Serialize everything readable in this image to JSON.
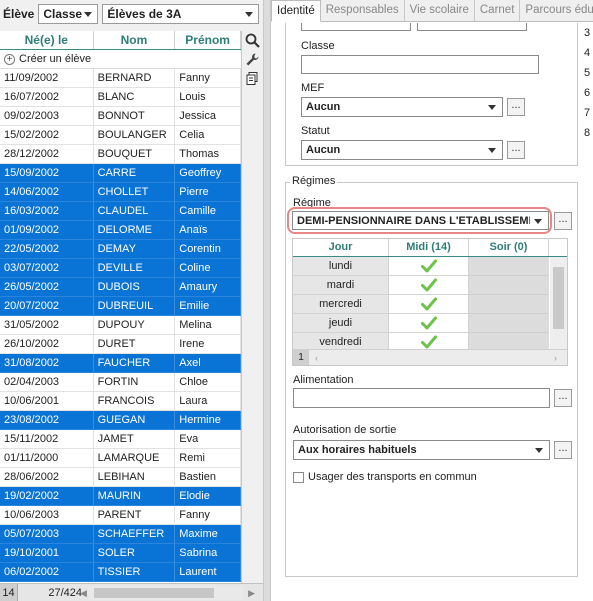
{
  "left": {
    "eleve_label": "Élève",
    "type_select": "Classe",
    "class_select": "Élèves de 3A",
    "columns": [
      "Né(e) le",
      "Nom",
      "Prénom"
    ],
    "create_label": "Créer un élève",
    "students": [
      {
        "date": "11/09/2002",
        "nom": "BERNARD",
        "prenom": "Fanny",
        "sel": false
      },
      {
        "date": "16/07/2002",
        "nom": "BLANC",
        "prenom": "Louis",
        "sel": false
      },
      {
        "date": "09/02/2003",
        "nom": "BONNOT",
        "prenom": "Jessica",
        "sel": false
      },
      {
        "date": "15/02/2002",
        "nom": "BOULANGER",
        "prenom": "Celia",
        "sel": false
      },
      {
        "date": "28/12/2002",
        "nom": "BOUQUET",
        "prenom": "Thomas",
        "sel": false
      },
      {
        "date": "15/09/2002",
        "nom": "CARRE",
        "prenom": "Geoffrey",
        "sel": true
      },
      {
        "date": "14/06/2002",
        "nom": "CHOLLET",
        "prenom": "Pierre",
        "sel": true
      },
      {
        "date": "16/03/2002",
        "nom": "CLAUDEL",
        "prenom": "Camille",
        "sel": true
      },
      {
        "date": "01/09/2002",
        "nom": "DELORME",
        "prenom": "Anaïs",
        "sel": true
      },
      {
        "date": "22/05/2002",
        "nom": "DEMAY",
        "prenom": "Corentin",
        "sel": true
      },
      {
        "date": "03/07/2002",
        "nom": "DEVILLE",
        "prenom": "Coline",
        "sel": true
      },
      {
        "date": "26/05/2002",
        "nom": "DUBOIS",
        "prenom": "Amaury",
        "sel": true
      },
      {
        "date": "20/07/2002",
        "nom": "DUBREUIL",
        "prenom": "Emilie",
        "sel": true
      },
      {
        "date": "31/05/2002",
        "nom": "DUPOUY",
        "prenom": "Melina",
        "sel": false
      },
      {
        "date": "26/10/2002",
        "nom": "DURET",
        "prenom": "Irene",
        "sel": false
      },
      {
        "date": "31/08/2002",
        "nom": "FAUCHER",
        "prenom": "Axel",
        "sel": true
      },
      {
        "date": "02/04/2003",
        "nom": "FORTIN",
        "prenom": "Chloe",
        "sel": false
      },
      {
        "date": "10/06/2001",
        "nom": "FRANCOIS",
        "prenom": "Laura",
        "sel": false
      },
      {
        "date": "23/08/2002",
        "nom": "GUEGAN",
        "prenom": "Hermine",
        "sel": true
      },
      {
        "date": "15/11/2002",
        "nom": "JAMET",
        "prenom": "Eva",
        "sel": false
      },
      {
        "date": "01/11/2000",
        "nom": "LAMARQUE",
        "prenom": "Remi",
        "sel": false
      },
      {
        "date": "28/06/2002",
        "nom": "LEBIHAN",
        "prenom": "Bastien",
        "sel": false
      },
      {
        "date": "19/02/2002",
        "nom": "MAURIN",
        "prenom": "Elodie",
        "sel": true
      },
      {
        "date": "10/06/2003",
        "nom": "PARENT",
        "prenom": "Fanny",
        "sel": false
      },
      {
        "date": "05/07/2003",
        "nom": "SCHAEFFER",
        "prenom": "Maxime",
        "sel": true
      },
      {
        "date": "19/10/2001",
        "nom": "SOLER",
        "prenom": "Sabrina",
        "sel": true
      },
      {
        "date": "06/02/2002",
        "nom": "TISSIER",
        "prenom": "Laurent",
        "sel": true
      }
    ],
    "page_box": "14",
    "count": "27/424"
  },
  "tabs": [
    "Identité",
    "Responsables",
    "Vie scolaire",
    "Carnet",
    "Parcours éduca"
  ],
  "form": {
    "classe_label": "Classe",
    "mef_label": "MEF",
    "mef_value": "Aucun",
    "statut_label": "Statut",
    "statut_value": "Aucun",
    "regimes_title": "Régimes",
    "regime_label": "Régime",
    "regime_value": "DEMI-PENSIONNAIRE DANS L'ETABLISSEMENT",
    "schedule_cols": [
      "Jour",
      "Midi (14)",
      "Soir (0)"
    ],
    "days": [
      "lundi",
      "mardi",
      "mercredi",
      "jeudi",
      "vendredi"
    ],
    "schedule_page": "1",
    "alimentation_label": "Alimentation",
    "sortie_label": "Autorisation de sortie",
    "sortie_value": "Aux horaires habituels",
    "transport_label": "Usager des transports en commun",
    "dots": "...",
    "side_numbers": [
      "3",
      "4",
      "5",
      "6",
      "7",
      "8"
    ]
  },
  "colors": {
    "selection": "#0a74d6",
    "header_teal": "#2e7d78",
    "highlight": "#e88585",
    "check": "#6cc24a"
  }
}
